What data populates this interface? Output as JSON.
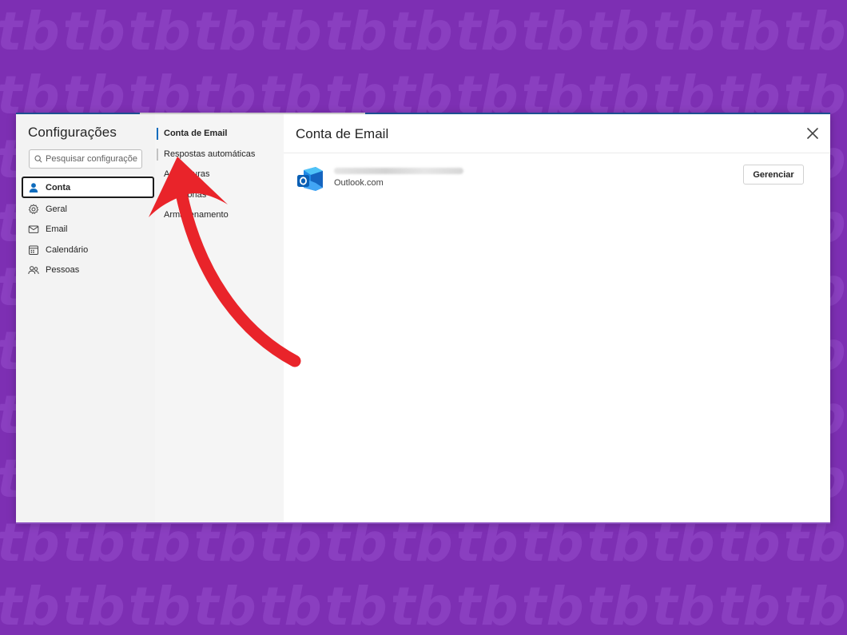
{
  "colors": {
    "background": "#7d2fb3",
    "accent": "#0f6cbd",
    "annotation_arrow": "#e9242a"
  },
  "settings": {
    "title": "Configurações",
    "search_placeholder": "Pesquisar configuraçõe",
    "nav": [
      {
        "label": "Conta",
        "icon": "person-icon",
        "active": true
      },
      {
        "label": "Geral",
        "icon": "gear-icon",
        "active": false
      },
      {
        "label": "Email",
        "icon": "mail-icon",
        "active": false
      },
      {
        "label": "Calendário",
        "icon": "calendar-icon",
        "active": false
      },
      {
        "label": "Pessoas",
        "icon": "people-icon",
        "active": false
      }
    ]
  },
  "subnav": [
    {
      "label": "Conta de Email",
      "active": true
    },
    {
      "label": "Respostas automáticas",
      "active": false
    },
    {
      "label": "Assinaturas",
      "active": false
    },
    {
      "label": "Categorias",
      "active": false
    },
    {
      "label": "Armazenamento",
      "active": false
    }
  ],
  "main": {
    "title": "Conta de Email",
    "close_icon": "close-icon",
    "account": {
      "logo_icon": "outlook-icon",
      "type": "Outlook.com",
      "manage_label": "Gerenciar"
    }
  },
  "annotation": {
    "icon": "curved-arrow-icon"
  }
}
